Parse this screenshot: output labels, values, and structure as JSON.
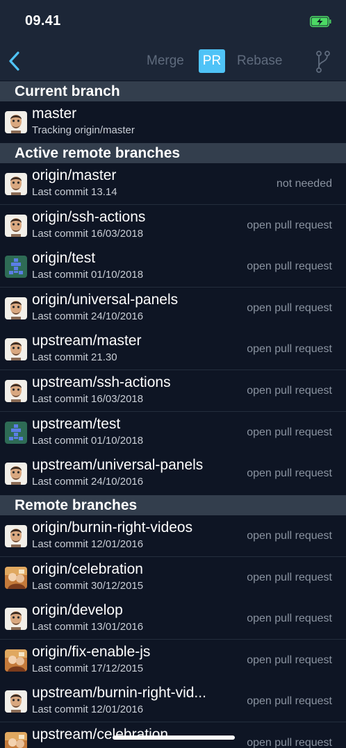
{
  "status": {
    "time": "09.41"
  },
  "nav": {
    "merge": "Merge",
    "pr": "PR",
    "rebase": "Rebase"
  },
  "sections": {
    "current": "Current branch",
    "active": "Active remote branches",
    "remote": "Remote branches"
  },
  "current_branch": {
    "name": "master",
    "sub": "Tracking origin/master",
    "avatar": "person"
  },
  "active_branches": [
    {
      "name": "origin/master",
      "sub": "Last commit 13.14",
      "action": "not needed",
      "avatar": "person"
    },
    {
      "name": "origin/ssh-actions",
      "sub": "Last commit 16/03/2018",
      "action": "open pull request",
      "avatar": "person"
    },
    {
      "name": "origin/test",
      "sub": "Last commit 01/10/2018",
      "action": "open pull request",
      "avatar": "identicon"
    },
    {
      "name": "origin/universal-panels",
      "sub": "Last commit 24/10/2016",
      "action": "open pull request",
      "avatar": "person"
    },
    {
      "name": "upstream/master",
      "sub": "Last commit 21.30",
      "action": "open pull request",
      "avatar": "person"
    },
    {
      "name": "upstream/ssh-actions",
      "sub": "Last commit 16/03/2018",
      "action": "open pull request",
      "avatar": "person"
    },
    {
      "name": "upstream/test",
      "sub": "Last commit 01/10/2018",
      "action": "open pull request",
      "avatar": "identicon"
    },
    {
      "name": "upstream/universal-panels",
      "sub": "Last commit 24/10/2016",
      "action": "open pull request",
      "avatar": "person"
    }
  ],
  "remote_branches": [
    {
      "name": "origin/burnin-right-videos",
      "sub": "Last commit 12/01/2016",
      "action": "open pull request",
      "avatar": "person"
    },
    {
      "name": "origin/celebration",
      "sub": "Last commit 30/12/2015",
      "action": "open pull request",
      "avatar": "photo"
    },
    {
      "name": "origin/develop",
      "sub": "Last commit 13/01/2016",
      "action": "open pull request",
      "avatar": "person"
    },
    {
      "name": "origin/fix-enable-js",
      "sub": "Last commit 17/12/2015",
      "action": "open pull request",
      "avatar": "photo"
    },
    {
      "name": "upstream/burnin-right-vid...",
      "sub": "Last commit 12/01/2016",
      "action": "open pull request",
      "avatar": "person"
    },
    {
      "name": "upstream/celebration",
      "sub": "",
      "action": "open pull request",
      "avatar": "photo"
    }
  ],
  "colors": {
    "accent": "#4fc3f7",
    "background": "#0e1524",
    "bar": "#1c2637",
    "section": "#333e4d",
    "battery": "#4cd964"
  }
}
